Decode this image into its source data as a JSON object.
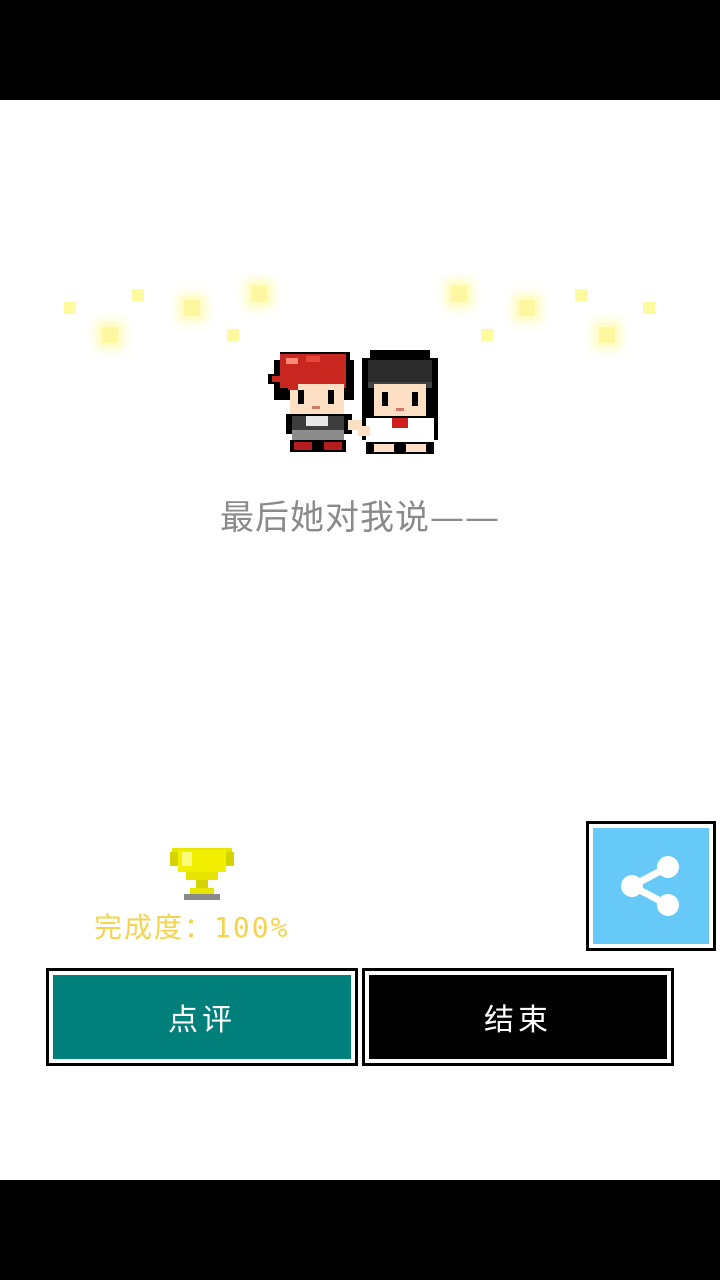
{
  "story": {
    "message": "最后她对我说——"
  },
  "result": {
    "completion_label": "完成度：100%",
    "completion_value": 1.0,
    "trophy_icon": "trophy-icon"
  },
  "actions": {
    "review_label": "点评",
    "end_label": "结束",
    "share_icon": "share-icon"
  },
  "colors": {
    "review_bg": "#017f7b",
    "end_bg": "#000000",
    "share_bg": "#66c9f7",
    "completion_text": "#f3d44c",
    "message_text": "#8a8a8a"
  }
}
